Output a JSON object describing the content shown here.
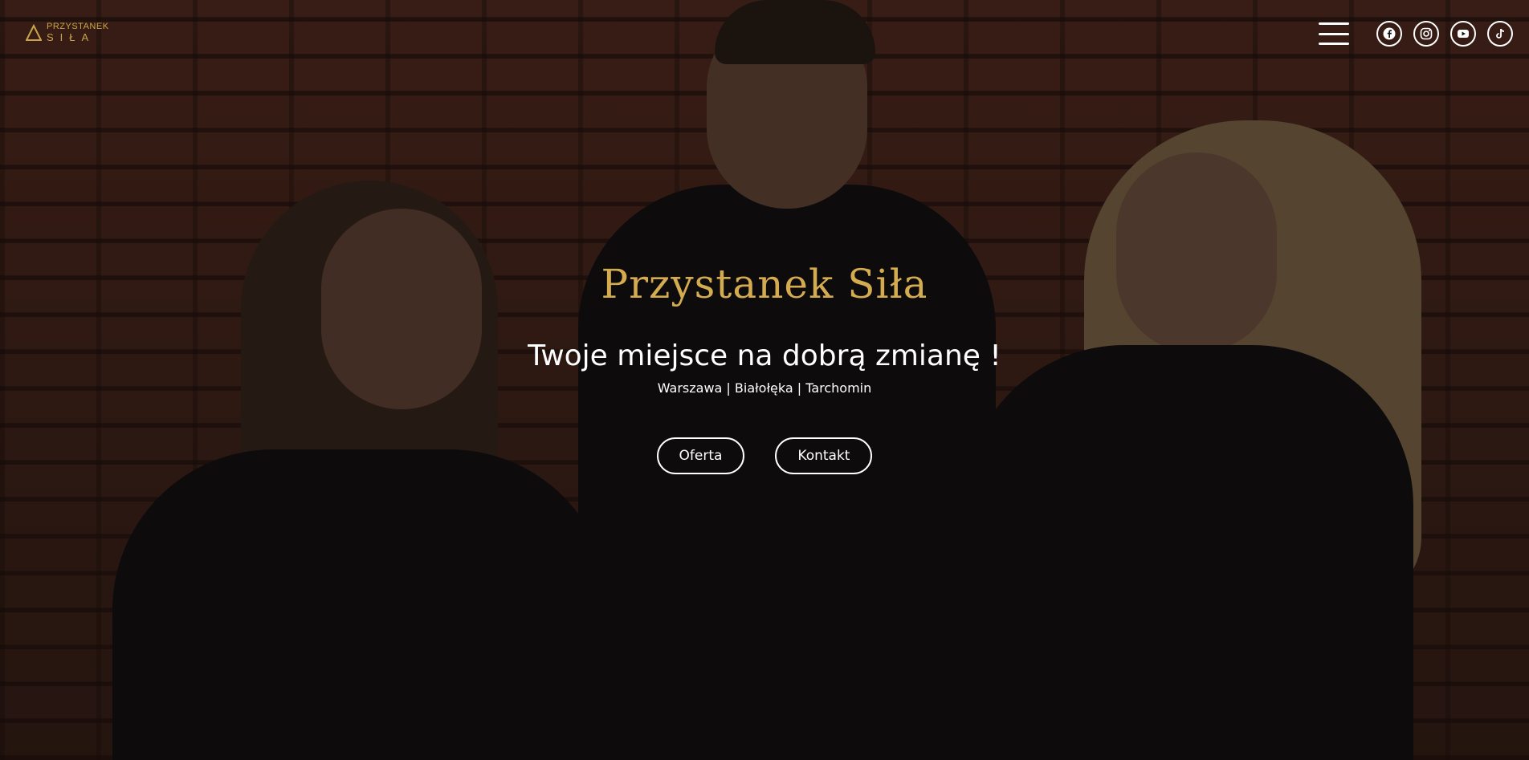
{
  "header": {
    "logo": {
      "top": "PRZYSTANEK",
      "bottom": "SIŁA"
    },
    "menu_icon": "hamburger-icon",
    "socials": [
      {
        "name": "facebook-icon"
      },
      {
        "name": "instagram-icon"
      },
      {
        "name": "youtube-icon"
      },
      {
        "name": "tiktok-icon"
      }
    ]
  },
  "hero": {
    "title": "Przystanek Siła",
    "tagline": "Twoje miejsce na dobrą zmianę !",
    "locations": "Warszawa | Białołęka | Tarchomin",
    "buttons": {
      "offer": "Oferta",
      "contact": "Kontakt"
    }
  },
  "colors": {
    "accent": "#d4ac4f",
    "text": "#ffffff"
  }
}
